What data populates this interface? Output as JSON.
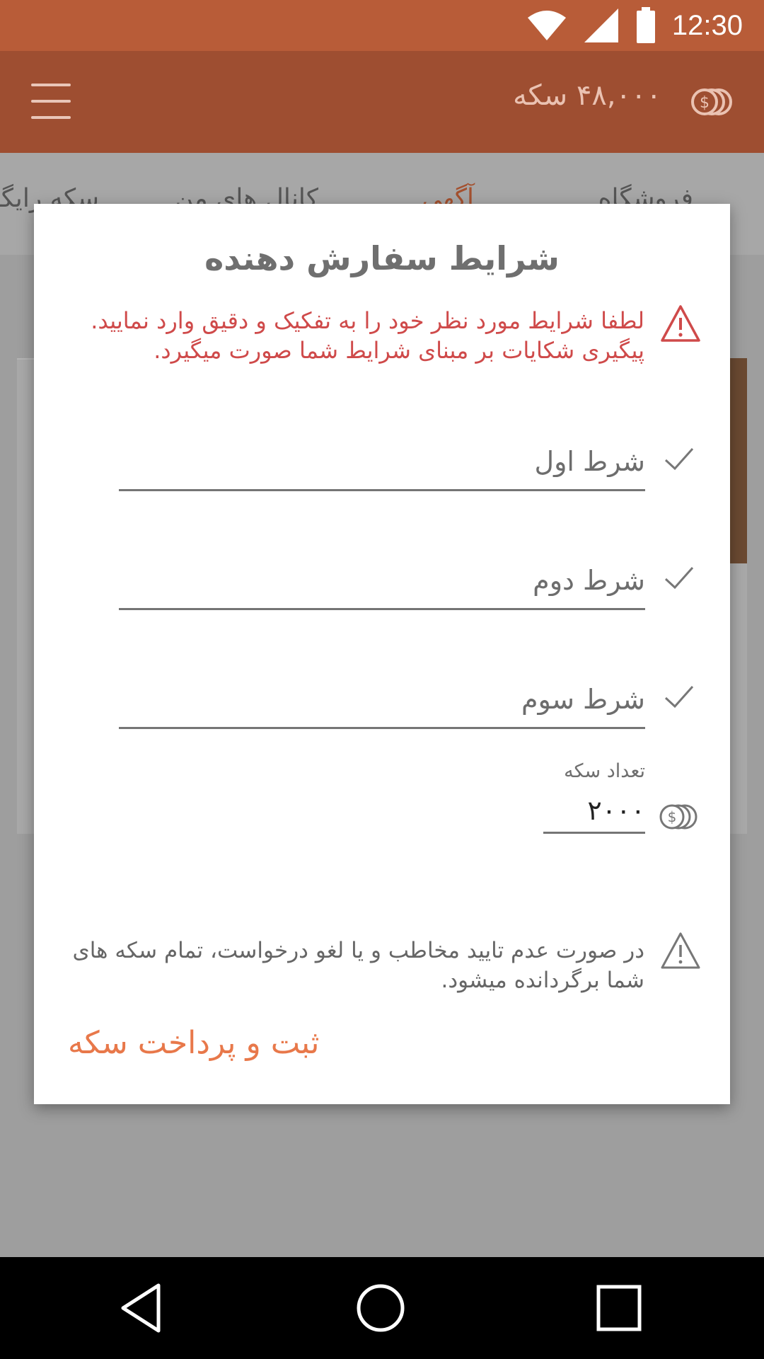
{
  "status_bar": {
    "time": "12:30",
    "icons": [
      "wifi-icon",
      "signal-icon",
      "battery-icon"
    ]
  },
  "app_bar": {
    "balance": "۴۸,۰۰۰ سکه",
    "icons": [
      "menu-icon",
      "coin-icon"
    ]
  },
  "tabs": [
    {
      "label": "فروشگاه"
    },
    {
      "label": "آگهی",
      "active": true
    },
    {
      "label": "کانال های من"
    },
    {
      "label": "سکه رایگان"
    }
  ],
  "dialog": {
    "title": "شرایط سفارش دهنده",
    "warning_top": "لطفا شرایط مورد نظر خود را به تفکیک و دقیق وارد نمایید. پیگیری شکایات بر مبنای شرایط شما صورت میگیرد.",
    "conditions": [
      {
        "placeholder": "شرط اول"
      },
      {
        "placeholder": "شرط دوم"
      },
      {
        "placeholder": "شرط سوم"
      }
    ],
    "coin_label": "تعداد سکه",
    "coin_value": "۲۰۰۰",
    "warning_bottom": "در صورت عدم تایید مخاطب و یا لغو درخواست، تمام سکه های شما برگردانده میشود.",
    "submit_label": "ثبت و پرداخت سکه"
  },
  "nav": {
    "icons": [
      "back-icon",
      "home-icon",
      "recents-icon"
    ]
  },
  "colors": {
    "status_bar": "#b85c38",
    "app_bar": "#9e4e31",
    "accent": "#e8784a",
    "warning_red": "#cf4a4a"
  }
}
